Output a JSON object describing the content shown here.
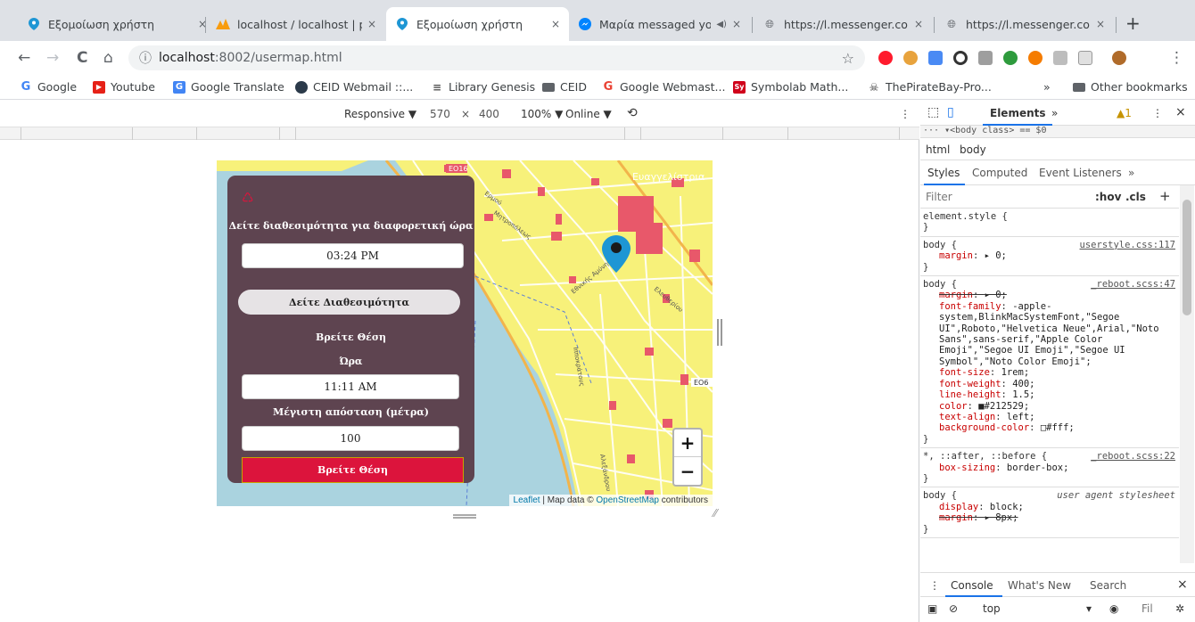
{
  "tabs": [
    {
      "title": "Εξομοίωση χρήστη",
      "fav": "marker-icon",
      "close": "×"
    },
    {
      "title": "localhost / localhost | ph",
      "fav": "phpmyadmin-icon",
      "close": "×"
    },
    {
      "title": "Εξομοίωση χρήστη",
      "fav": "marker-icon",
      "close": "×"
    },
    {
      "title": "Μαρία messaged yo",
      "fav": "messenger-icon",
      "close": "×",
      "audio": "◀)"
    },
    {
      "title": "https://l.messenger.com",
      "fav": "globe-icon",
      "close": "×"
    },
    {
      "title": "https://l.messenger.com",
      "fav": "globe-icon",
      "close": "×"
    }
  ],
  "newtab": "+",
  "nav": {
    "back": "←",
    "forward": "→",
    "reload": "C",
    "home": "⌂"
  },
  "address": {
    "info": "ⓘ",
    "host": "localhost",
    "path": ":8002/usermap.html",
    "star": "☆"
  },
  "bookmarks": [
    {
      "label": "Google",
      "icon": "G",
      "color": "#4285f4"
    },
    {
      "label": "Youtube",
      "icon": "▶",
      "color": "#e62117"
    },
    {
      "label": "Google Translate",
      "icon": "G",
      "color": "#4285f4"
    },
    {
      "label": "CEID Webmail ::...",
      "icon": "●",
      "color": "#333"
    },
    {
      "label": "Library Genesis",
      "icon": "≡",
      "color": "#555"
    },
    {
      "label": "CEID",
      "icon": "▆",
      "color": "#555"
    },
    {
      "label": "Google Webmast...",
      "icon": "G",
      "color": "#34a853"
    },
    {
      "label": "Symbolab Math...",
      "icon": "Sy",
      "color": "#d0021b"
    },
    {
      "label": "ThePirateBay-Pro...",
      "icon": "☠",
      "color": "#333"
    }
  ],
  "bookmarks_more": "»",
  "other_bookmarks": "Other bookmarks",
  "devbar": {
    "mode": "Responsive ▼",
    "width": "570",
    "times": "×",
    "height": "400",
    "zoom": "100% ▼",
    "network": "Online ▼",
    "rotate": "⟲",
    "more": "⋮"
  },
  "map": {
    "labels": {
      "evangelistria": "Ευαγγελίστρια",
      "eo16": "ΕΟ16",
      "eo6": "ΕΟ6"
    },
    "zoom_in": "+",
    "zoom_out": "−",
    "attribution": {
      "leaflet": "Leaflet",
      "sep": " | Map data © ",
      "osm": "OpenStreetMap",
      "contrib": " contributors"
    }
  },
  "panel": {
    "logo": "♺",
    "heading": "Δείτε διαθεσιμότητα για διαφορετική ώρα",
    "time1": "03:24 PM",
    "btn_availability": "Δείτε Διαθεσιμότητα",
    "find_title": "Βρείτε Θέση",
    "hour_label": "Ώρα",
    "time2": "11:11 AM",
    "distance_label": "Μέγιστη απόσταση (μέτρα)",
    "distance": "100",
    "btn_find": "Βρείτε Θέση"
  },
  "devtools": {
    "elements": "Elements",
    "more_tabs": "»",
    "warn": "▲1",
    "menu": "⋮",
    "close": "×",
    "crumb": "··· ▾<body class> == $0",
    "path_html": "html",
    "path_body": "body",
    "sub_styles": "Styles",
    "sub_computed": "Computed",
    "sub_events": "Event Listeners",
    "sub_more": "»",
    "filter": "Filter",
    "hov": ":hov",
    "cls": ".cls",
    "plus": "+",
    "console": "Console",
    "whatsnew": "What's New",
    "search": "Search",
    "console_close": "×",
    "ctx_top": "top",
    "ctx_filter": "Fil"
  },
  "rules": [
    {
      "sel": "element.style {",
      "src": "",
      "props": []
    },
    {
      "sel": "body {",
      "src": "userstyle.css:117",
      "props": [
        {
          "n": "margin",
          "v": "▸ 0;",
          "strike": false
        }
      ]
    },
    {
      "sel": "body {",
      "src": "_reboot.scss:47",
      "props": [
        {
          "n": "margin",
          "v": "▸ 0;",
          "strike": true
        },
        {
          "n": "font-family",
          "v": "-apple-system,BlinkMacSystemFont,\"Segoe UI\",Roboto,\"Helvetica Neue\",Arial,\"Noto Sans\",sans-serif,\"Apple Color Emoji\",\"Segoe UI Emoji\",\"Segoe UI Symbol\",\"Noto Color Emoji\";",
          "strike": false
        },
        {
          "n": "font-size",
          "v": "1rem;",
          "strike": false
        },
        {
          "n": "font-weight",
          "v": "400;",
          "strike": false
        },
        {
          "n": "line-height",
          "v": "1.5;",
          "strike": false
        },
        {
          "n": "color",
          "v": "■#212529;",
          "strike": false
        },
        {
          "n": "text-align",
          "v": "left;",
          "strike": false
        },
        {
          "n": "background-color",
          "v": "□#fff;",
          "strike": false
        }
      ]
    },
    {
      "sel": "*, ::after, ::before {",
      "src": "_reboot.scss:22",
      "props": [
        {
          "n": "box-sizing",
          "v": "border-box;",
          "strike": false
        }
      ]
    },
    {
      "sel": "body {",
      "src": "user agent stylesheet",
      "ua": true,
      "props": [
        {
          "n": "display",
          "v": "block;",
          "strike": false
        },
        {
          "n": "margin",
          "v": "▸ 8px;",
          "strike": true
        }
      ]
    }
  ],
  "colors": {
    "panel": "#5e4450",
    "accent": "#dc143c",
    "map_road": "#f7f17a",
    "map_water": "#aad3df",
    "pin": "#1e96d4"
  }
}
